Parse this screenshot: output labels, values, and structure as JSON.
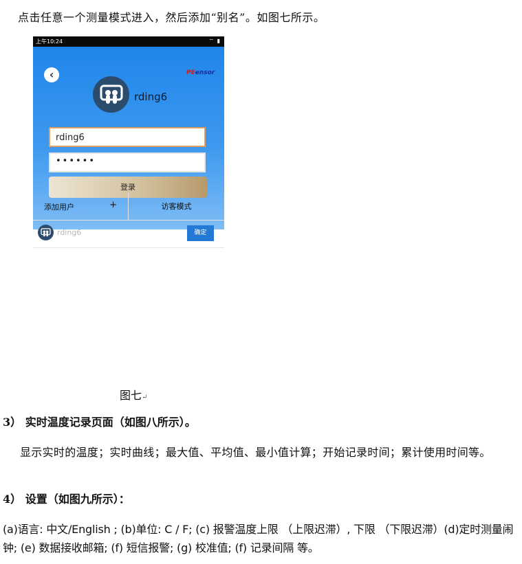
{
  "intro": "点击任意一个测量模式进入，然后添加“别名”。如图七所示。",
  "phone": {
    "status_time": "上午10:24",
    "brand_prefix": "PE",
    "brand_suffix": "ensor",
    "username_display": "rding6",
    "username_input": "rding6",
    "password_mask": "••••••",
    "login_label": "登录",
    "add_user_label": "添加用户",
    "add_user_plus": "+",
    "guest_mode_label": "访客模式",
    "alias_value": "rding6",
    "confirm_label": "确定",
    "colors": {
      "header_blue": "#1f86ea",
      "confirm_blue": "#2479d6",
      "avatar": "#2b4c6c"
    }
  },
  "caption": "图七",
  "section3": {
    "heading": "3） 实时温度记录页面（如图八所示）。",
    "body": "显示实时的温度；实时曲线；最大值、平均值、最小值计算；开始记录时间；累计使用时间等。"
  },
  "section4": {
    "heading": "4） 设置（如图九所示）：",
    "body": "(a)语言: 中文/English ; (b)单位: C / F; (c) 报警温度上限 （上限迟滞）, 下限 （下限迟滞）(d)定时测量闹钟; (e) 数据接收邮箱; (f) 短信报警; (g) 校准值; (f) 记录间隔 等。"
  }
}
